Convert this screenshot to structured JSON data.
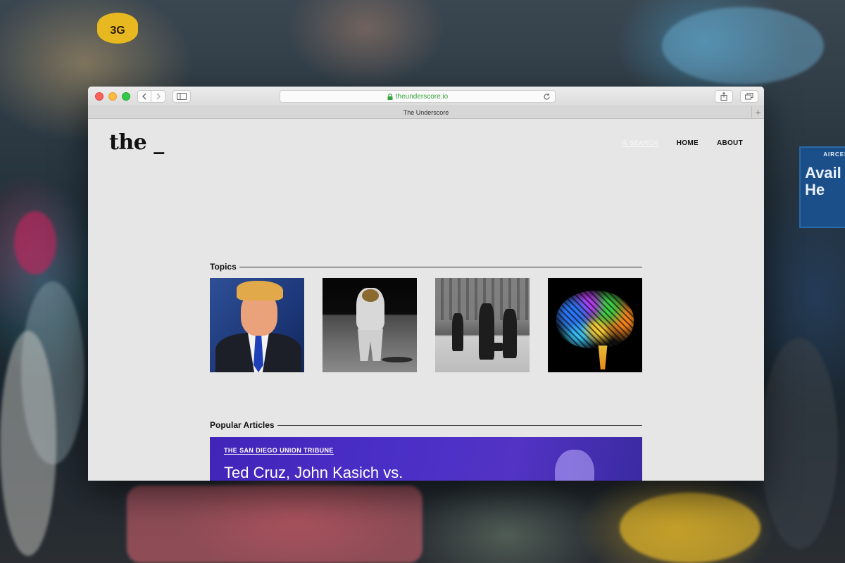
{
  "browser": {
    "url": "theunderscore.io",
    "tab_title": "The Underscore"
  },
  "site": {
    "logo": "the _",
    "nav": {
      "search": "SEARCH",
      "home": "HOME",
      "about": "ABOUT"
    }
  },
  "topics": {
    "heading": "Topics",
    "items": [
      {
        "icon": "politician-portrait-image"
      },
      {
        "icon": "astronaut-moon-image"
      },
      {
        "icon": "archival-travelers-image"
      },
      {
        "icon": "circuit-brain-image"
      }
    ]
  },
  "popular": {
    "heading": "Popular Articles",
    "articles": [
      {
        "source": "THE SAN DIEGO UNION TRIBUNE",
        "headline": "Ted Cruz, John Kasich vs."
      }
    ]
  },
  "background": {
    "sign_text": "Avail He",
    "sign_small": "AIRCEL",
    "badge_text": "3G"
  },
  "colors": {
    "accent_url": "#35a43c",
    "article_bg": "#4124b8"
  }
}
